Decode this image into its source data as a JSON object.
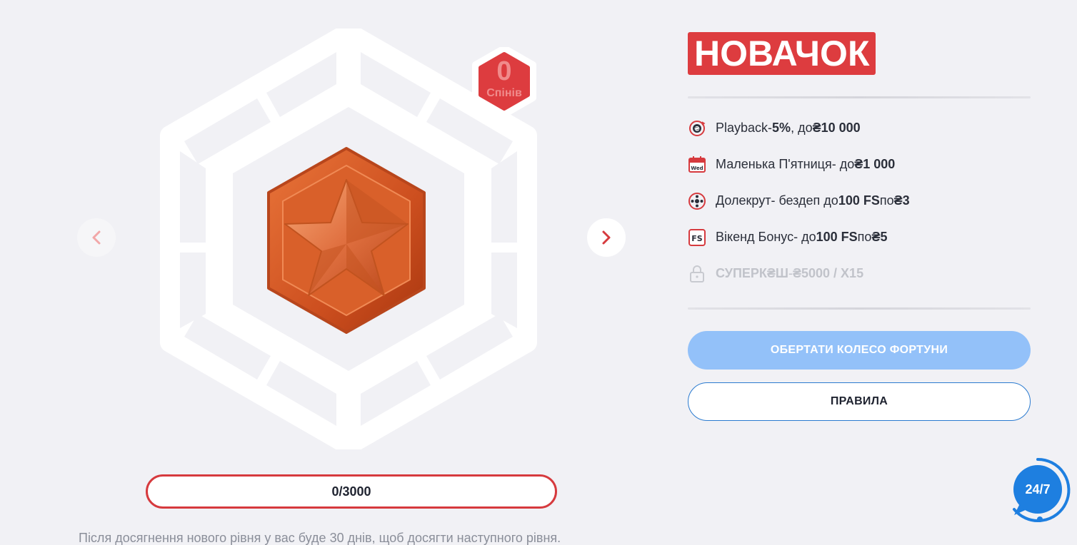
{
  "wheel": {
    "spins_count": "0",
    "spins_label": "Спінів",
    "medal_icon": "star-medal-icon"
  },
  "navigation": {
    "prev_icon": "chevron-left-icon",
    "next_icon": "chevron-right-icon"
  },
  "progress": {
    "text": "0/3000",
    "current": 0,
    "target": 3000
  },
  "footnote": "Після досягнення нового рівня у вас буде 30 днів, щоб досягти наступного рівня.",
  "level": {
    "title": "НОВАЧОК",
    "perks": [
      {
        "icon": "playback-icon",
        "name": "Playback",
        "sep": " - ",
        "bold1": "5%",
        "mid": ", до ",
        "bold2": "₴10 000",
        "tail": "",
        "bold3": ""
      },
      {
        "icon": "calendar-wed-icon",
        "name": "Маленька П'ятниця",
        "sep": " - до ",
        "bold1": "₴1 000",
        "mid": "",
        "bold2": "",
        "tail": "",
        "bold3": ""
      },
      {
        "icon": "reel-icon",
        "name": "Долекрут",
        "sep": " - бездеп до ",
        "bold1": "100 FS",
        "mid": " по ",
        "bold2": "₴3",
        "tail": "",
        "bold3": ""
      },
      {
        "icon": "fs-icon",
        "name": "Вікенд Бонус",
        "sep": " - до ",
        "bold1": "100 FS",
        "mid": " по ",
        "bold2": "₴5",
        "tail": "",
        "bold3": ""
      },
      {
        "icon": "lock-icon",
        "name": "СУПЕРКЕШ",
        "sep": " - ",
        "bold1": "₴5000 / X15",
        "mid": "",
        "bold2": "",
        "tail": "",
        "bold3": ""
      }
    ],
    "perk_superkash_display": "СУПЕРК₴Ш"
  },
  "buttons": {
    "spin_label": "ОБЕРТАТИ КОЛЕСО ФОРТУНИ",
    "rules_label": "ПРАВИЛА"
  },
  "support": {
    "label": "24/7",
    "icon": "support-chat-icon"
  },
  "colors": {
    "accent_red": "#dd3c3f",
    "accent_blue": "#2b7bd0",
    "spin_button": "#93c1f9",
    "bronze": "#d9602a"
  }
}
